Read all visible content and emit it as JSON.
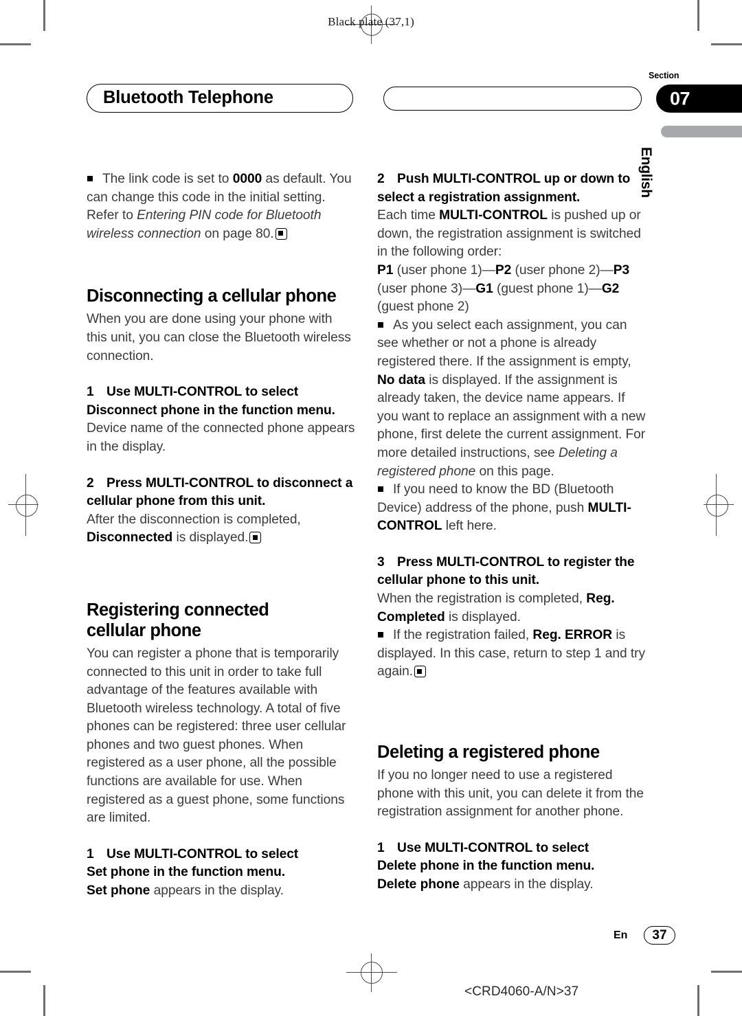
{
  "plate": {
    "slug": "Black plate (37,1)"
  },
  "header": {
    "chapter_title": "Bluetooth Telephone",
    "section_word": "Section",
    "section_number": "07",
    "language": "English"
  },
  "footer": {
    "language_code": "En",
    "page_number": "37",
    "print_slug": "<CRD4060-A/N>37"
  },
  "colors": {
    "section_tab": "#000000",
    "language_bar": "#a6a8ab",
    "body_text": "#3b3b3b"
  },
  "left_column": {
    "note_intro": {
      "pre": "The link code is set to ",
      "bold": "0000",
      "mid": " as default. You can change this code in the initial setting. Refer to ",
      "italic": "Entering PIN code for Bluetooth wireless connection",
      "post": " on page 80."
    },
    "heading_disconnect": "Disconnecting a cellular phone",
    "disconnect_intro": "When you are done using your phone with this unit, you can close the Bluetooth wireless connection.",
    "step1": {
      "num": "1",
      "head_a": "Use MULTI-CONTROL to select",
      "head_b": "Disconnect phone in the function menu.",
      "body": "Device name of the connected phone appears in the display."
    },
    "step2": {
      "num": "2",
      "head_a": "Press MULTI-CONTROL to disconnect a",
      "head_b": "cellular phone from this unit.",
      "body_pre": "After the disconnection is completed, ",
      "body_bold": "Disconnected",
      "body_post": " is displayed."
    },
    "heading_register_a": "Registering connected",
    "heading_register_b": "cellular phone",
    "register_intro": "You can register a phone that is temporarily connected to this unit in order to take full advantage of the features available with Bluetooth wireless technology. A total of five phones can be registered: three user cellular phones and two guest phones. When registered as a user phone, all the possible functions are available for use. When registered as a guest phone, some functions are limited.",
    "step_set": {
      "num": "1",
      "head_a": "Use MULTI-CONTROL to select",
      "head_b": "Set phone in the function menu.",
      "body_bold": "Set phone",
      "body_post": " appears in the display."
    }
  },
  "right_column": {
    "step2": {
      "num": "2",
      "head_a": "Push MULTI-CONTROL up or down to",
      "head_b": "select a registration assignment.",
      "body_pre": "Each time ",
      "body_bold": "MULTI-CONTROL",
      "body_post": " is pushed up or down, the registration assignment is switched in the following order:",
      "order": [
        {
          "code": "P1",
          "text": " (user phone 1)—"
        },
        {
          "code": "P2",
          "text": " (user phone 2)—"
        },
        {
          "code": "P3",
          "text": " (user phone 3)—"
        },
        {
          "code": "G1",
          "text": " (guest phone 1)—"
        },
        {
          "code": "G2",
          "text": " (guest phone 2)"
        }
      ]
    },
    "note_assignment": {
      "pre": "As you select each assignment, you can see whether or not a phone is already registered there. If the assignment is empty, ",
      "bold": "No data",
      "mid": " is displayed. If the assignment is already taken, the device name appears. If you want to replace an assignment with a new phone, first delete the current assignment. For more detailed instructions, see ",
      "italic": "Deleting a registered phone",
      "post": " on this page."
    },
    "note_bd": {
      "pre": "If you need to know the BD (Bluetooth Device) address of the phone, push ",
      "bold": "MULTI-CONTROL",
      "post": " left here."
    },
    "step3": {
      "num": "3",
      "head_a": "Press MULTI-CONTROL to register the",
      "head_b": "cellular phone to this unit.",
      "body_pre": "When the registration is completed, ",
      "body_bold": "Reg. Completed",
      "body_post": " is displayed."
    },
    "note_error": {
      "pre": "If the registration failed, ",
      "bold": "Reg. ERROR",
      "post": " is displayed. In this case, return to step 1 and try again."
    },
    "heading_delete": "Deleting a registered phone",
    "delete_intro": "If you no longer need to use a registered phone with this unit, you can delete it from the registration assignment for another phone.",
    "step_delete": {
      "num": "1",
      "head_a": "Use MULTI-CONTROL to select",
      "head_b": "Delete phone in the function menu.",
      "body_bold": "Delete phone",
      "body_post": " appears in the display."
    }
  }
}
